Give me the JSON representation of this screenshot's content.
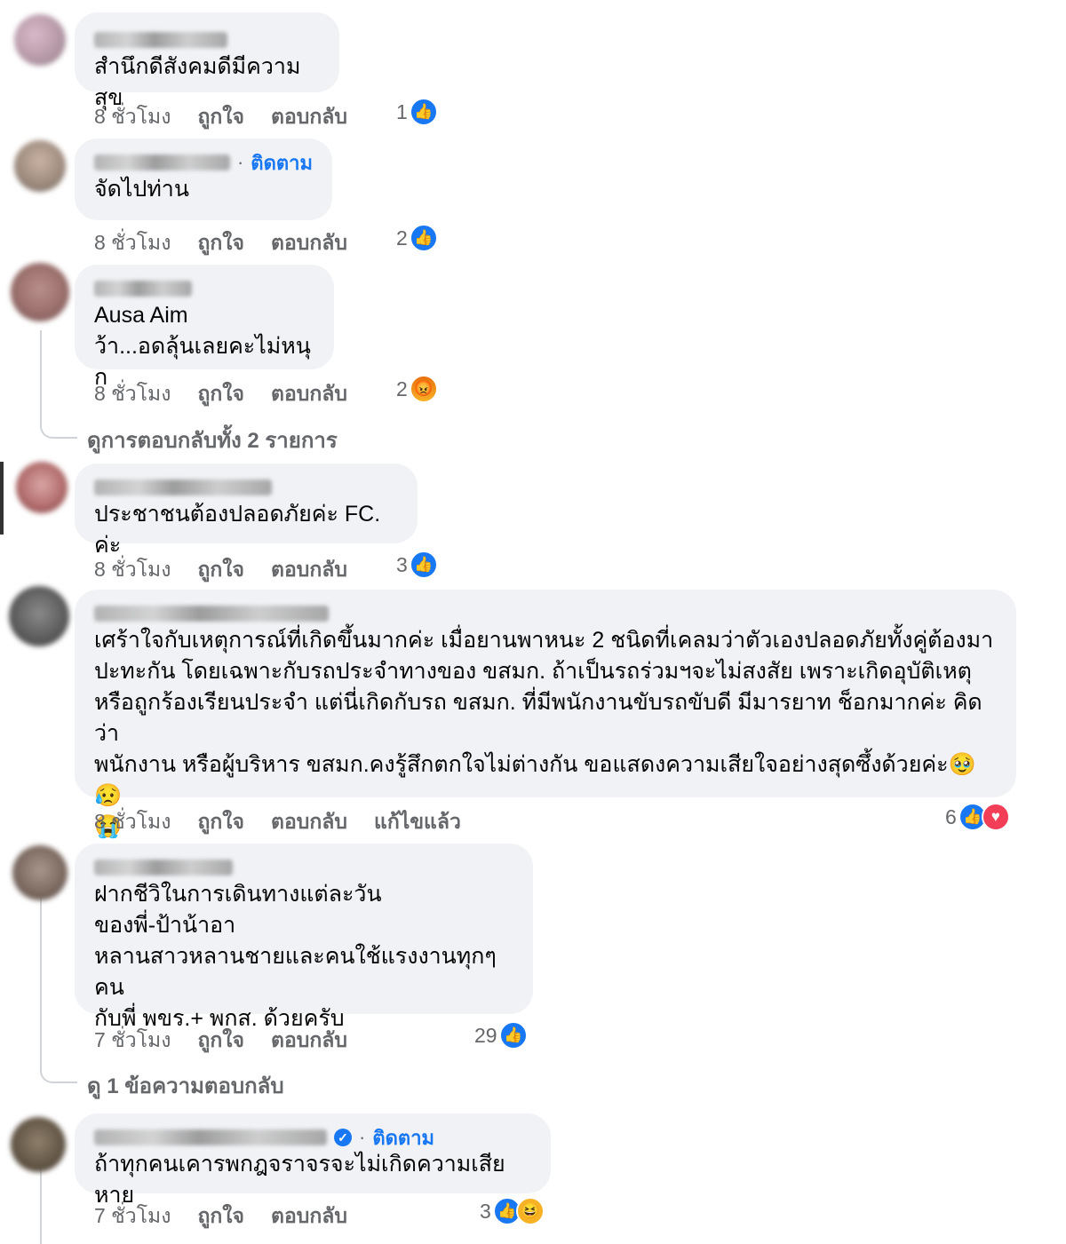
{
  "labels": {
    "like": "ถูกใจ",
    "reply": "ตอบกลับ",
    "follow": "ติดตาม",
    "edited": "แก้ไขแล้ว",
    "dot": "·"
  },
  "comments": [
    {
      "text": "สำนึกดีสังคมดีมีความสุข",
      "time": "8 ชั่วโมง",
      "count": "1",
      "reactions": [
        "like"
      ]
    },
    {
      "text": "จัดไปท่าน",
      "time": "8 ชั่วโมง",
      "count": "2",
      "reactions": [
        "like"
      ],
      "follow": true
    },
    {
      "text": "Ausa Aim\nว้า...อดลุ้นเลยคะไม่หนุก",
      "time": "8 ชั่วโมง",
      "count": "2",
      "reactions": [
        "angry"
      ]
    },
    {
      "text": "ประชาชนต้องปลอดภัยค่ะ FC. ค่ะ",
      "time": "8 ชั่วโมง",
      "count": "3",
      "reactions": [
        "like"
      ]
    },
    {
      "text": "เศร้าใจกับเหตุการณ์ที่เกิดขึ้นมากค่ะ เมื่อยานพาหนะ 2 ชนิดที่เคลมว่าตัวเองปลอดภัยทั้งคู่ต้องมา\nปะทะกัน โดยเฉพาะกับรถประจำทางของ ขสมก. ถ้าเป็นรถร่วมฯจะไม่สงสัย เพราะเกิดอุบัติเหตุ\nหรือถูกร้องเรียนประจำ แต่นี่เกิดกับรถ ขสมก. ที่มีพนักงานขับรถขับดี มีมารยาท ช็อกมากค่ะ คิดว่า\nพนักงาน หรือผู้บริหาร ขสมก.คงรู้สึกตกใจไม่ต่างกัน ขอแสดงความเสียใจอย่างสุดซึ้งด้วยค่ะ🥹😥\n😭",
      "time": "8 ชั่วโมง",
      "count": "6",
      "reactions": [
        "like",
        "heart"
      ],
      "edited": true
    },
    {
      "text": "ฝากชีวิในการเดินทางแต่ละวัน\nของพี่-ป้าน้าอา\nหลานสาวหลานชายและคนใช้แรงงานทุกๆคน\nกับพี่ พขร.+ พกส. ด้วยครับ",
      "time": "7 ชั่วโมง",
      "count": "29",
      "reactions": [
        "like"
      ]
    },
    {
      "text": "ถ้าทุกคนเคารพกฎจราจรจะไม่เกิดความเสียหาย",
      "time": "7 ชั่วโมง",
      "count": "3",
      "reactions": [
        "like",
        "haha"
      ],
      "follow": true,
      "verified": true
    }
  ],
  "view_replies": [
    "ดูการตอบกลับทั้ง 2 รายการ",
    "ดู 1 ข้อความตอบกลับ"
  ],
  "icons": {
    "like": "like-icon",
    "heart": "love-icon",
    "angry": "angry-icon",
    "haha": "haha-icon",
    "verified": "verified-badge-icon"
  }
}
